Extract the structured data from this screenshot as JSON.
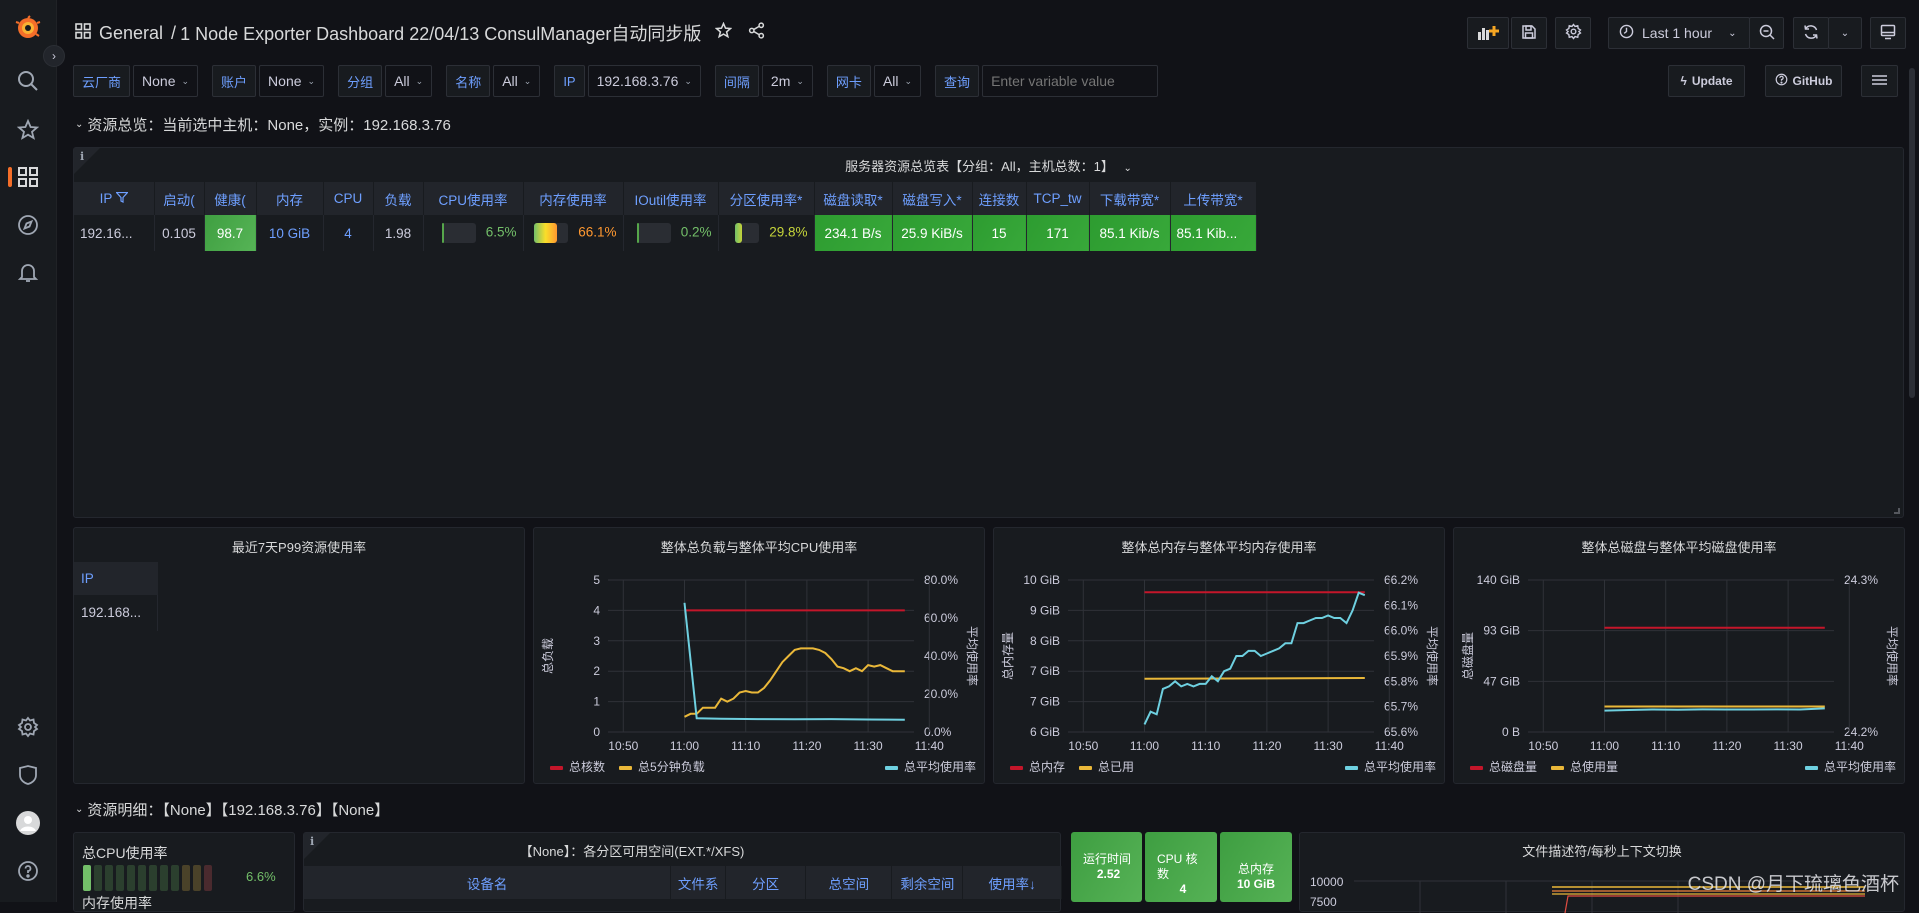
{
  "breadcrumb": {
    "folder": "General",
    "separator": "/",
    "dashboard": "1 Node Exporter Dashboard 22/04/13 ConsulManager自动同步版"
  },
  "toolbar": {
    "time_range": "Last 1 hour",
    "update_label": "Update",
    "github_label": "GitHub"
  },
  "variables": [
    {
      "label": "云厂商",
      "value": "None"
    },
    {
      "label": "账户",
      "value": "None"
    },
    {
      "label": "分组",
      "value": "All"
    },
    {
      "label": "名称",
      "value": "All"
    },
    {
      "label": "IP",
      "value": "192.168.3.76"
    },
    {
      "label": "间隔",
      "value": "2m"
    },
    {
      "label": "网卡",
      "value": "All"
    }
  ],
  "query": {
    "label": "查询",
    "placeholder": "Enter variable value"
  },
  "row1": {
    "title": "资源总览：当前选中主机：None，实例：192.168.3.76"
  },
  "overview_table": {
    "title": "服务器资源总览表【分组：All，主机总数：1】",
    "headers": [
      "IP",
      "启动(",
      "健康(",
      "内存",
      "CPU",
      "负载",
      "CPU使用率",
      "内存使用率",
      "IOutil使用率",
      "分区使用率*",
      "磁盘读取*",
      "磁盘写入*",
      "连接数",
      "TCP_tw",
      "下载带宽*",
      "上传带宽*"
    ],
    "row": {
      "ip": "192.16...",
      "uptime": "0.105",
      "health": "98.7",
      "memory": "10 GiB",
      "cpu": "4",
      "load": "1.98",
      "cpu_usage": "6.5%",
      "cpu_usage_pct": 6.5,
      "mem_usage": "66.1%",
      "mem_usage_pct": 66.1,
      "ioutil": "0.2%",
      "ioutil_pct": 0.2,
      "partition": "29.8%",
      "partition_pct": 29.8,
      "disk_read": "234.1 B/s",
      "disk_write": "25.9 KiB/s",
      "connections": "15",
      "tcp_tw": "171",
      "download": "85.1 Kib/s",
      "upload": "85.1 Kib..."
    }
  },
  "p99_panel": {
    "title": "最近7天P99资源使用率",
    "header": "IP",
    "value": "192.168..."
  },
  "chart_data": [
    {
      "type": "line",
      "title": "整体总负载与整体平均CPU使用率",
      "xlabel": "",
      "ylabel": "总负载",
      "ylabel_right": "平均使用率",
      "x_ticks": [
        "10:50",
        "11:00",
        "11:10",
        "11:20",
        "11:30",
        "11:40"
      ],
      "y_ticks": [
        "0",
        "1",
        "2",
        "3",
        "4",
        "5"
      ],
      "y_right_ticks": [
        "0.0%",
        "20.0%",
        "40.0%",
        "60.0%",
        "80.0%"
      ],
      "ylim": [
        0,
        5
      ],
      "ylim_right": [
        0,
        80
      ],
      "series": [
        {
          "name": "总核数",
          "color": "#c4162a",
          "axis": "left",
          "x": [
            16,
            52
          ],
          "values": [
            4,
            4
          ]
        },
        {
          "name": "总5分钟负载",
          "color": "#eab839",
          "axis": "left",
          "x": [
            16,
            17,
            18,
            19,
            20,
            21,
            22,
            23,
            24,
            25,
            26,
            27,
            28,
            29,
            30,
            31,
            32,
            33,
            34,
            35,
            36,
            37,
            38,
            39,
            40,
            41,
            42,
            43,
            44,
            45,
            46,
            47,
            48,
            49,
            50,
            51,
            52
          ],
          "values": [
            0.5,
            0.6,
            0.6,
            0.8,
            0.8,
            0.8,
            1.1,
            1.0,
            1.1,
            1.3,
            1.35,
            1.3,
            1.3,
            1.45,
            1.7,
            2.0,
            2.3,
            2.5,
            2.7,
            2.75,
            2.75,
            2.75,
            2.7,
            2.6,
            2.4,
            2.15,
            2.1,
            2.0,
            2.1,
            2.0,
            2.2,
            2.15,
            2.2,
            2.1,
            2.0,
            2.0,
            2.0
          ]
        },
        {
          "name": "总平均使用率",
          "color": "#6ed0e0",
          "axis": "right",
          "x": [
            16,
            18,
            22,
            28,
            34,
            40,
            46,
            52
          ],
          "values": [
            68,
            7.2,
            7.0,
            6.8,
            6.7,
            6.8,
            6.6,
            6.5
          ]
        }
      ],
      "legend": "bottom"
    },
    {
      "type": "line",
      "title": "整体总内存与整体平均内存使用率",
      "ylabel": "总内存量",
      "ylabel_right": "平均使用率",
      "x_ticks": [
        "10:50",
        "11:00",
        "11:10",
        "11:20",
        "11:30",
        "11:40"
      ],
      "y_ticks": [
        "6 GiB",
        "7 GiB",
        "7 GiB",
        "8 GiB",
        "9 GiB",
        "10 GiB"
      ],
      "y_right_ticks": [
        "65.6%",
        "65.7%",
        "65.8%",
        "65.9%",
        "66.0%",
        "66.1%",
        "66.2%"
      ],
      "ylim": [
        6,
        10
      ],
      "ylim_right": [
        65.6,
        66.2
      ],
      "series": [
        {
          "name": "总内存",
          "color": "#c4162a",
          "axis": "left",
          "x": [
            16,
            52
          ],
          "values": [
            9.68,
            9.68
          ]
        },
        {
          "name": "总已用",
          "color": "#eab839",
          "axis": "left",
          "x": [
            16,
            52
          ],
          "values": [
            7.4,
            7.42
          ]
        },
        {
          "name": "总平均使用率",
          "color": "#6ed0e0",
          "axis": "right",
          "x": [
            16,
            17,
            18,
            19,
            20,
            21,
            22,
            23,
            24,
            25,
            26,
            27,
            28,
            29,
            30,
            31,
            32,
            33,
            34,
            35,
            36,
            37,
            38,
            39,
            40,
            41,
            42,
            43,
            44,
            45,
            46,
            47,
            48,
            49,
            50,
            51,
            52
          ],
          "values": [
            65.63,
            65.68,
            65.67,
            65.77,
            65.78,
            65.8,
            65.78,
            65.79,
            65.78,
            65.79,
            65.79,
            65.82,
            65.8,
            65.84,
            65.85,
            65.9,
            65.9,
            65.92,
            65.92,
            65.9,
            65.91,
            65.92,
            65.93,
            65.95,
            65.95,
            66.03,
            66.03,
            66.04,
            66.05,
            66.05,
            66.06,
            66.05,
            66.05,
            66.03,
            66.08,
            66.15,
            66.14
          ]
        }
      ],
      "legend": "bottom"
    },
    {
      "type": "line",
      "title": "整体总磁盘与整体平均磁盘使用率",
      "ylabel": "总磁盘量",
      "ylabel_right": "平均使用率",
      "x_ticks": [
        "10:50",
        "11:00",
        "11:10",
        "11:20",
        "11:30",
        "11:40"
      ],
      "y_ticks": [
        "0 B",
        "47 GiB",
        "93 GiB",
        "140 GiB"
      ],
      "y_right_ticks": [
        "24.2%",
        "24.3%"
      ],
      "ylim": [
        0,
        140
      ],
      "ylim_right": [
        24.2,
        24.3
      ],
      "series": [
        {
          "name": "总磁盘量",
          "color": "#c4162a",
          "axis": "left",
          "x": [
            16,
            52
          ],
          "values": [
            96,
            96
          ]
        },
        {
          "name": "总使用量",
          "color": "#eab839",
          "axis": "left",
          "x": [
            16,
            52
          ],
          "values": [
            23.5,
            23.5
          ]
        },
        {
          "name": "总平均使用率",
          "color": "#6ed0e0",
          "axis": "right",
          "x": [
            16,
            20,
            24,
            28,
            32,
            36,
            40,
            44,
            48,
            52
          ],
          "values": [
            24.2141,
            24.2145,
            24.2148,
            24.2146,
            24.2149,
            24.2148,
            24.2148,
            24.2149,
            24.2148,
            24.2155
          ]
        }
      ],
      "legend": "bottom"
    },
    {
      "type": "line",
      "title": "文件描述符/每秒上下文切换",
      "y_ticks": [
        "10000",
        "7500"
      ],
      "series": []
    }
  ],
  "row2": {
    "title": "资源明细：【None】【192.168.3.76】【None】"
  },
  "bargauge": {
    "label": "总CPU使用率",
    "value": "6.6%",
    "value_pct": 6.6,
    "next_label": "内存使用率"
  },
  "partition_table": {
    "title": "【None】：各分区可用空间(EXT.*/XFS)",
    "headers": [
      "设备名",
      "文件系",
      "分区",
      "总空间",
      "剩余空间",
      "使用率↓"
    ]
  },
  "stats": [
    {
      "label": "运行时间",
      "value": "2.52"
    },
    {
      "label": "CPU 核数",
      "value": "4"
    },
    {
      "label": "总内存",
      "value": "10 GiB"
    }
  ],
  "watermark": "CSDN @月下琉璃色酒杯"
}
